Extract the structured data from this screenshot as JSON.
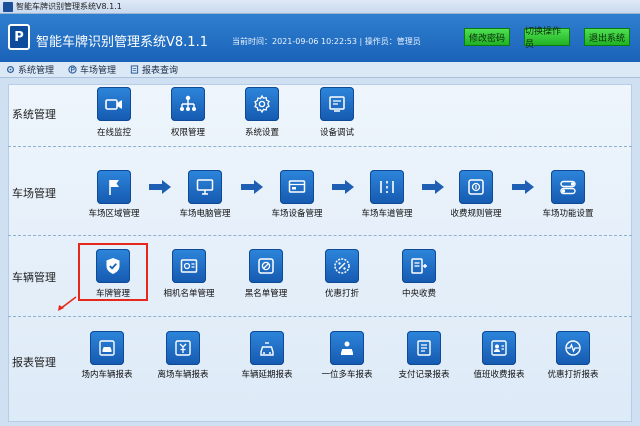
{
  "window": {
    "title": "智能车牌识别管理系统V8.1.1"
  },
  "header": {
    "logo_text": "P",
    "app_title": "智能车牌识别管理系统V8.1.1",
    "meta_text": "当前时间：2021-09-06 10:22:53 | 操作员：管理员",
    "buttons": [
      "修改密码",
      "切换操作员",
      "退出系统"
    ]
  },
  "menu": [
    {
      "label": "系统管理",
      "icon": "gear-icon"
    },
    {
      "label": "车场管理",
      "icon": "parking-icon"
    },
    {
      "label": "报表查询",
      "icon": "report-icon"
    }
  ],
  "sections": {
    "system": {
      "label": "系统管理",
      "items": [
        {
          "label": "在线监控",
          "icon": "camera-icon"
        },
        {
          "label": "权限管理",
          "icon": "org-chart-icon"
        },
        {
          "label": "系统设置",
          "icon": "gear-icon"
        },
        {
          "label": "设备调试",
          "icon": "device-icon"
        }
      ]
    },
    "parking": {
      "label": "车场管理",
      "items": [
        {
          "label": "车场区域管理",
          "icon": "flag-icon"
        },
        {
          "label": "车场电脑管理",
          "icon": "monitor-icon"
        },
        {
          "label": "车场设备管理",
          "icon": "equipment-icon"
        },
        {
          "label": "车场车道管理",
          "icon": "lane-icon"
        },
        {
          "label": "收费规则管理",
          "icon": "fee-rule-icon"
        },
        {
          "label": "车场功能设置",
          "icon": "toggle-icon"
        }
      ]
    },
    "vehicle": {
      "label": "车辆管理",
      "items": [
        {
          "label": "车牌管理",
          "icon": "shield-check-icon"
        },
        {
          "label": "相机名单管理",
          "icon": "camera-list-icon"
        },
        {
          "label": "黑名单管理",
          "icon": "ban-icon"
        },
        {
          "label": "优惠打折",
          "icon": "discount-icon"
        },
        {
          "label": "中央收费",
          "icon": "central-pay-icon"
        }
      ]
    },
    "reports": {
      "label": "报表管理",
      "items": [
        {
          "label": "场内车辆报表",
          "icon": "car-in-icon"
        },
        {
          "label": "离场车辆报表",
          "icon": "car-out-icon"
        },
        {
          "label": "车辆延期报表",
          "icon": "car-extend-icon"
        },
        {
          "label": "一位多车报表",
          "icon": "multi-car-icon"
        },
        {
          "label": "支付记录报表",
          "icon": "payment-icon"
        },
        {
          "label": "值班收费报表",
          "icon": "duty-icon"
        },
        {
          "label": "优惠打折报表",
          "icon": "discount-report-icon"
        }
      ]
    }
  }
}
